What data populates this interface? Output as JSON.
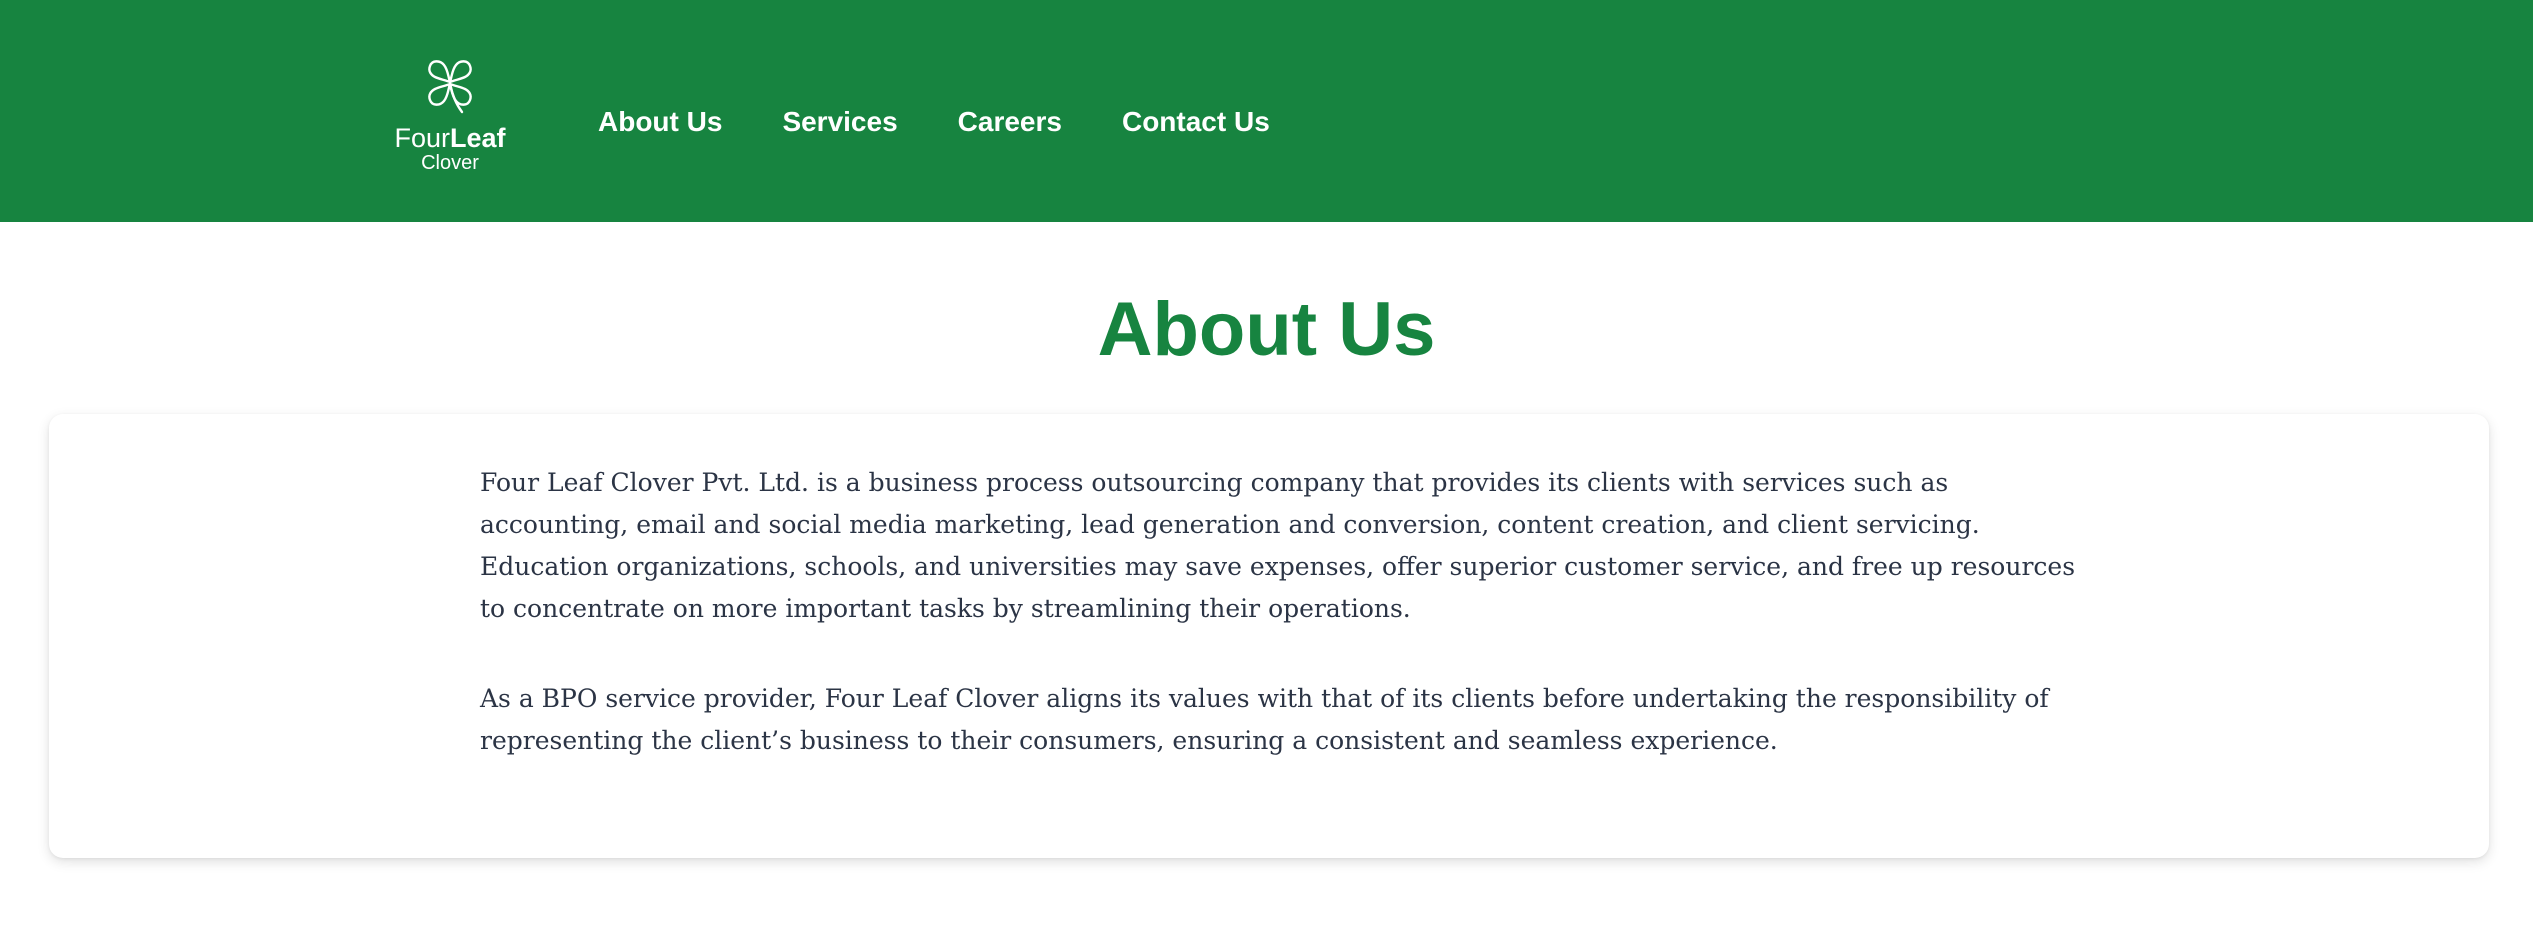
{
  "header": {
    "logo": {
      "word_regular": "Four",
      "word_bold": "Leaf",
      "subtitle": "Clover"
    },
    "nav": [
      {
        "label": "About Us"
      },
      {
        "label": "Services"
      },
      {
        "label": "Careers"
      },
      {
        "label": "Contact Us"
      }
    ]
  },
  "main": {
    "title": "About Us",
    "paragraphs": [
      "Four Leaf Clover Pvt. Ltd. is a business process outsourcing company that provides its clients with services such as accounting, email and social media marketing, lead generation and conversion, content creation, and client servicing. Education organizations, schools, and universities may save expenses, offer superior customer service, and free up resources to concentrate on more important tasks by streamlining their operations.",
      "As a BPO service provider, Four Leaf Clover aligns its values with that of its clients before undertaking the responsibility of representing the client’s business to their consumers, ensuring a consistent and seamless experience."
    ]
  },
  "colors": {
    "brand_green": "#178440",
    "header_text": "#ffffff",
    "body_text": "#2b3445",
    "background": "#ffffff"
  },
  "icons": {
    "logo": "four-leaf-clover-icon"
  }
}
